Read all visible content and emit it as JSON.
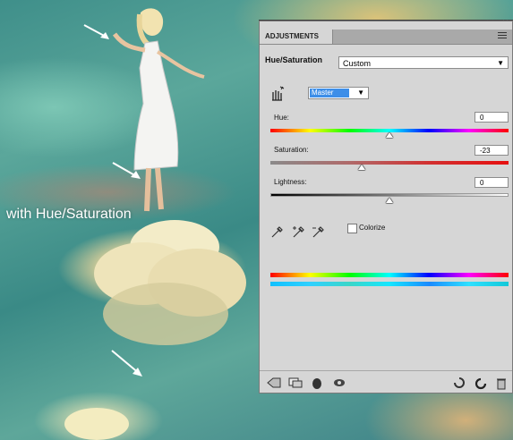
{
  "caption": "with Hue/Saturation",
  "panel": {
    "tab_label": "ADJUSTMENTS",
    "title": "Hue/Saturation",
    "preset_value": "Custom",
    "channel_value": "Master",
    "hue": {
      "label": "Hue:",
      "value": "0",
      "level": 0.5
    },
    "saturation": {
      "label": "Saturation:",
      "value": "-23",
      "level": 0.385
    },
    "lightness": {
      "label": "Lightness:",
      "value": "0",
      "level": 0.5
    },
    "colorize_label": "Colorize",
    "colorize_checked": false
  },
  "icons": [
    "collapse-icon",
    "close-icon",
    "panel-menu-icon",
    "on-image-adjust-icon",
    "eyedropper-icon",
    "eyedropper-add-icon",
    "eyedropper-subtract-icon",
    "return-to-list-icon",
    "clip-to-layer-icon",
    "visibility-icon",
    "view-previous-icon",
    "reset-icon",
    "delete-icon"
  ]
}
